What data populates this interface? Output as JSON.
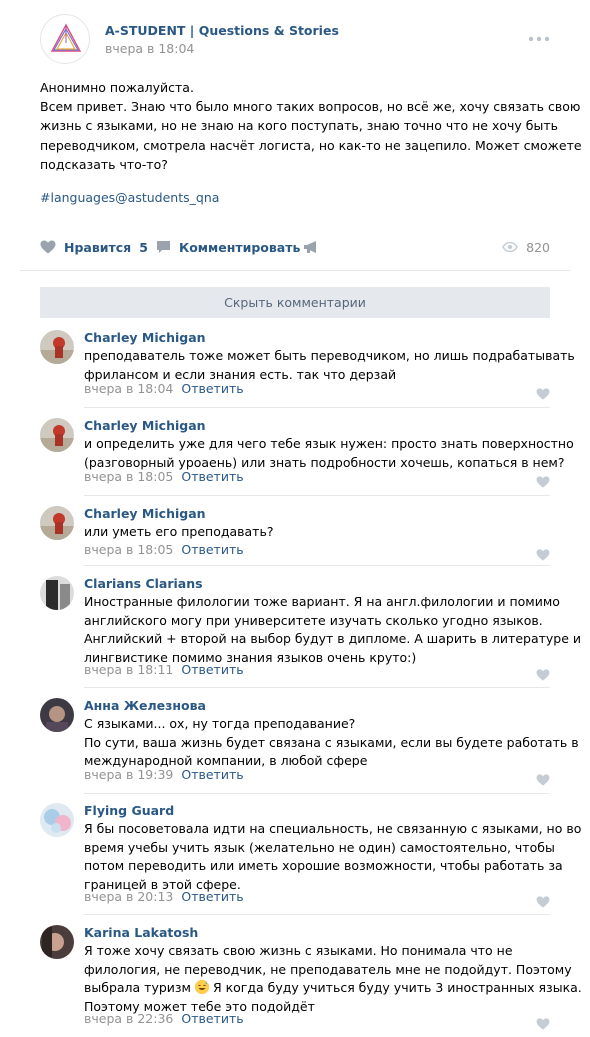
{
  "post": {
    "group_name": "A-STUDENT | Questions & Stories",
    "date": "вчера в 18:04",
    "text_lines": [
      "Анонимно пожалуйста.",
      "Всем привет. Знаю что было много таких вопросов, но всё же, хочу связать свою",
      "жизнь с языками, но не знаю на кого поступать, знаю точно что не хочу быть",
      "переводчиком, смотрела насчёт логиста, но как-то не зацепило. Может сможете",
      "подсказать что-то?"
    ],
    "hashtag": "#languages@astudents_qna",
    "like_label": "Нравится",
    "like_count": "5",
    "comment_label": "Комментировать",
    "views": "820"
  },
  "hide_comments_label": "Скрыть комментарии",
  "reply_label": "Ответить",
  "comments": [
    {
      "author": "Charley Michigan",
      "lines": [
        "преподаватель тоже может быть переводчиком, но лишь подрабатывать",
        "фрилансом и если знания есть. так что дерзай"
      ],
      "time": "вчера в 18:04"
    },
    {
      "author": "Charley Michigan",
      "lines": [
        "и определить уже для чего тебе язык нужен: просто знать поверхностно",
        "(разговорный уроаень) или знать подробности хочешь, копаться в нем?"
      ],
      "time": "вчера в 18:05"
    },
    {
      "author": "Charley Michigan",
      "lines": [
        "или уметь его преподавать?"
      ],
      "time": "вчера в 18:05"
    },
    {
      "author": "Clarians Clarians",
      "lines": [
        "Иностранные филологии тоже вариант. Я на англ.филологии и помимо",
        "английского могу при университете изучать сколько угодно языков.",
        "Английский + второй на выбор будут в дипломе. А шарить в литературе и",
        "лингвистике помимо знания языков очень круто:)"
      ],
      "time": "вчера в 18:11"
    },
    {
      "author": "Анна Железнова",
      "lines": [
        "С языками... ох, ну тогда преподавание?",
        "По сути, ваша жизнь будет связана с языками, если вы будете работать в",
        "международной компании, в любой сфере"
      ],
      "time": "вчера в 19:39"
    },
    {
      "author": "Flying Guard",
      "lines": [
        "Я бы посоветовала идти на специальность, не связанную с языками, но во",
        "время учебы учить язык (желательно не один) самостоятельно, чтобы",
        "потом переводить или иметь хорошие возможности, чтобы работать за",
        "границей в этой сфере."
      ],
      "time": "вчера в 20:13"
    },
    {
      "author": "Karina Lakatosh",
      "lines": [
        "Я тоже хочу связать свою жизнь с языками. Но понимала что не",
        "филология, не переводчик, не преподаватель мне не подойдут. Поэтому",
        "",
        "Поэтому может тебе это подойдёт"
      ],
      "line3_before_emoji": "выбрала туризм",
      "line3_after_emoji": " Я когда буду учиться буду учить 3 иностранных языка.",
      "time": "вчера в 22:36"
    }
  ],
  "icons": {
    "more": "more-horizontal-icon",
    "like": "heart-icon",
    "comment": "comment-bubble-icon",
    "share": "megaphone-icon",
    "views": "eye-icon",
    "emoji": "sweat-smile-emoji"
  },
  "colors": {
    "link": "#2a5885",
    "muted": "#939393",
    "icon": "#99a2ad",
    "button_bg": "#e5e8ec"
  }
}
